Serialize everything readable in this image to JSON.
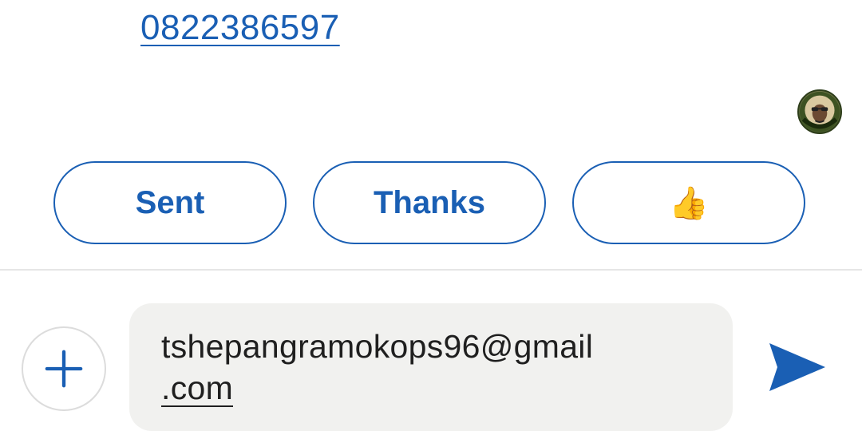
{
  "message": {
    "phone_link": "0822386597"
  },
  "quick_replies": [
    {
      "label": "Sent"
    },
    {
      "label": "Thanks"
    },
    {
      "label": "👍"
    }
  ],
  "composer": {
    "text_line1": "tshepangramokops96@gmail",
    "text_line2": ".com"
  },
  "icons": {
    "attach": "plus-icon",
    "send": "send-icon",
    "avatar": "contact-avatar"
  },
  "colors": {
    "accent": "#1a5fb4",
    "composer_bg": "#f1f1ef"
  }
}
